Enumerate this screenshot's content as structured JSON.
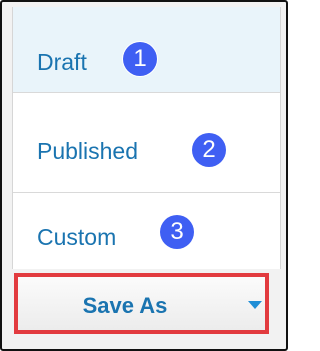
{
  "menu": {
    "items": [
      {
        "label": "Draft",
        "step": "1"
      },
      {
        "label": "Published",
        "step": "2"
      },
      {
        "label": "Custom",
        "step": "3"
      }
    ]
  },
  "save_as": {
    "label": "Save As",
    "dropdown_icon": "caret-down-icon"
  },
  "colors": {
    "link_blue": "#1a74b0",
    "badge_blue": "#3f5ff3",
    "highlight_red": "#e23b3f",
    "selected_row": "#e9f4fa"
  }
}
